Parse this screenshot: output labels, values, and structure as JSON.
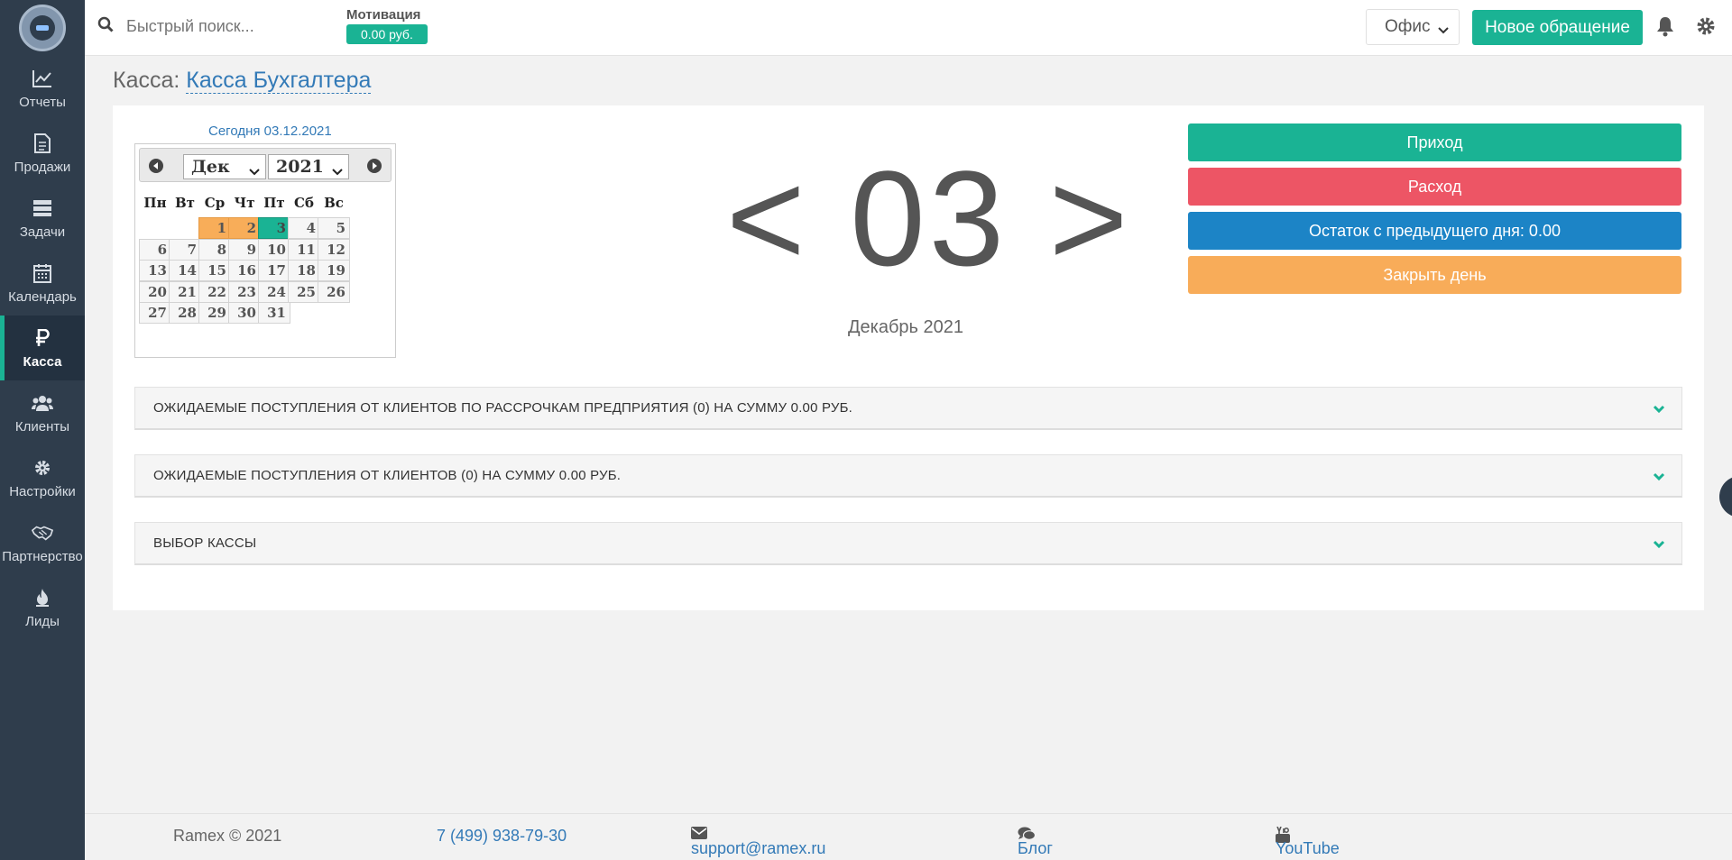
{
  "sidebar": {
    "items": [
      {
        "label": "Отчеты",
        "icon": "chart-line-icon"
      },
      {
        "label": "Продажи",
        "icon": "document-icon"
      },
      {
        "label": "Задачи",
        "icon": "tasks-icon"
      },
      {
        "label": "Календарь",
        "icon": "calendar-icon"
      },
      {
        "label": "Касса",
        "icon": "ruble-icon"
      },
      {
        "label": "Клиенты",
        "icon": "users-icon"
      },
      {
        "label": "Настройки",
        "icon": "gear-icon"
      },
      {
        "label": "Партнерство",
        "icon": "handshake-icon"
      },
      {
        "label": "Лиды",
        "icon": "fire-icon"
      }
    ]
  },
  "topbar": {
    "search_placeholder": "Быстрый поиск...",
    "motivation_label": "Мотивация",
    "motivation_value": "0.00 руб.",
    "office": "Офис",
    "new_request": "Новое обращение"
  },
  "page": {
    "title_prefix": "Касса:",
    "title_link": "Касса Бухгалтера"
  },
  "calendar": {
    "today_label": "Сегодня 03.12.2021",
    "month": "Дек",
    "year": "2021",
    "weekdays": [
      "Пн",
      "Вт",
      "Ср",
      "Чт",
      "Пт",
      "Сб",
      "Вс"
    ],
    "days": [
      "1",
      "2",
      "3",
      "4",
      "5",
      "6",
      "7",
      "8",
      "9",
      "10",
      "11",
      "12",
      "13",
      "14",
      "15",
      "16",
      "17",
      "18",
      "19",
      "20",
      "21",
      "22",
      "23",
      "24",
      "25",
      "26",
      "27",
      "28",
      "29",
      "30",
      "31"
    ]
  },
  "day_nav": {
    "text": "< 03 >",
    "month_label": "Декабрь 2021"
  },
  "actions": {
    "income": "Приход",
    "expense": "Расход",
    "rest": "Остаток с предыдущего дня: 0.00",
    "close_day": "Закрыть день"
  },
  "accordions": [
    "ОЖИДАЕМЫЕ ПОСТУПЛЕНИЯ ОТ КЛИЕНТОВ ПО РАССРОЧКАМ ПРЕДПРИЯТИЯ (0) НА СУММУ 0.00 РУБ.",
    "ОЖИДАЕМЫЕ ПОСТУПЛЕНИЯ ОТ КЛИЕНТОВ (0) НА СУММУ 0.00 РУБ.",
    "ВЫБОР КАССЫ"
  ],
  "footer": {
    "copyright": "Ramex © 2021",
    "phone": "7 (499) 938-79-30",
    "email": "support@ramex.ru",
    "blog": "Блог",
    "youtube": "YouTube"
  },
  "colors": {
    "sidebar": "#2f3d4c",
    "primary": "#1ab394",
    "danger": "#ed5565",
    "info": "#1c84c6",
    "warning": "#f8ac59"
  }
}
